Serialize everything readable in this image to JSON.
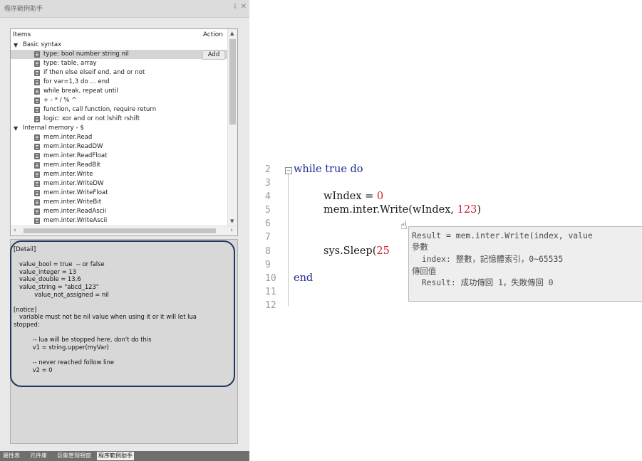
{
  "panel": {
    "title": "程序範例助手",
    "pin_icon": "pin-icon",
    "close_icon": "close-icon",
    "header": {
      "items": "Items",
      "action": "Action"
    },
    "groups": [
      {
        "label": "Basic syntax",
        "items": [
          "type: bool number string nil",
          "type: table, array",
          "if then else elseif end, and or not",
          "for var=1,3 do ... end",
          "while break, repeat until",
          "+ - * / % ^",
          "function, call function, require return",
          "logic: xor and or not lshift rshift"
        ]
      },
      {
        "label": "Internal memory - $",
        "items": [
          "mem.inter.Read",
          "mem.inter.ReadDW",
          "mem.inter.ReadFloat",
          "mem.inter.ReadBit",
          "mem.inter.Write",
          "mem.inter.WriteDW",
          "mem.inter.WriteFloat",
          "mem.inter.WriteBit",
          "mem.inter.ReadAscii",
          "mem.inter.WriteAscii"
        ]
      }
    ],
    "add_label": "Add",
    "detail": "[Detail]\n\n   value_bool = true  -- or false\n   value_integer = 13\n   value_double = 13.6\n   value_string = \"abcd_123\"\n           value_not_assigned = nil\n\n[notice]\n   variable must not be nil value when using it or it will let lua\nstopped:\n\n          -- lua will be stopped here, don't do this\n          v1 = string.upper(myVar)\n\n          -- never reached follow line\n          v2 = 0",
    "bottom_tabs": [
      "屬性表",
      "元件庫",
      "巨集管理視窗",
      "程序範例助手"
    ]
  },
  "editor": {
    "line_numbers": [
      "2",
      "3",
      "4",
      "5",
      "6",
      "7",
      "8",
      "9",
      "10",
      "11",
      "12"
    ],
    "code": {
      "while": "while",
      "true": "true",
      "do": "do",
      "windex": "wIndex",
      "eq": " = ",
      "zero": "0",
      "call_prefix": "mem.inter.Write(wIndex, ",
      "num123": "123",
      "call_suffix": ")",
      "sleep": "sys.Sleep(",
      "sleep_arg": "25",
      "end": "end"
    },
    "tooltip": [
      "Result = mem.inter.Write(index, value",
      "參數",
      "  index: 整數，記憶體索引，0~65535",
      "傳回值",
      "  Result: 成功傳回 1，失敗傳回 0"
    ]
  }
}
